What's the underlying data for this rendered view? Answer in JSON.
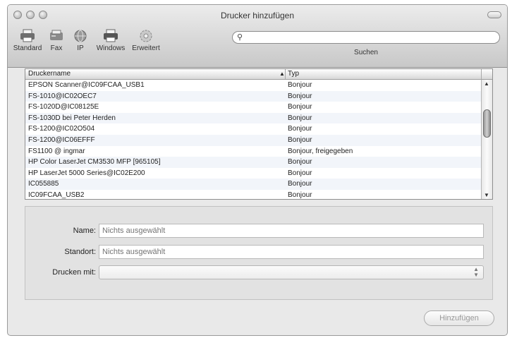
{
  "window": {
    "title": "Drucker hinzufügen"
  },
  "toolbar": {
    "items": [
      {
        "label": "Standard",
        "icon": "printer-icon"
      },
      {
        "label": "Fax",
        "icon": "fax-icon"
      },
      {
        "label": "IP",
        "icon": "globe-icon"
      },
      {
        "label": "Windows",
        "icon": "windows-printer-icon"
      },
      {
        "label": "Erweitert",
        "icon": "gear-icon"
      }
    ],
    "search": {
      "value": "",
      "label": "Suchen"
    }
  },
  "list": {
    "columns": [
      "Druckername",
      "Typ"
    ],
    "rows": [
      {
        "name": "EPSON Scanner@IC09FCAA_USB1",
        "type": "Bonjour"
      },
      {
        "name": "FS-1010@IC02OEC7",
        "type": "Bonjour"
      },
      {
        "name": "FS-1020D@IC08125E",
        "type": "Bonjour"
      },
      {
        "name": "FS-1030D bei Peter Herden",
        "type": "Bonjour"
      },
      {
        "name": "FS-1200@IC02O504",
        "type": "Bonjour"
      },
      {
        "name": "FS-1200@IC06EFFF",
        "type": "Bonjour"
      },
      {
        "name": "FS1100 @ ingmar",
        "type": "Bonjour, freigegeben"
      },
      {
        "name": "HP Color LaserJet CM3530 MFP [965105]",
        "type": "Bonjour"
      },
      {
        "name": "HP LaserJet 5000 Series@IC02E200",
        "type": "Bonjour"
      },
      {
        "name": "IC055885",
        "type": "Bonjour"
      },
      {
        "name": "IC09FCAA_USB2",
        "type": "Bonjour"
      }
    ]
  },
  "details": {
    "name_label": "Name:",
    "name_placeholder": "Nichts ausgewählt",
    "location_label": "Standort:",
    "location_placeholder": "Nichts ausgewählt",
    "driver_label": "Drucken mit:",
    "driver_value": ""
  },
  "add_button": {
    "label": "Hinzufügen"
  }
}
